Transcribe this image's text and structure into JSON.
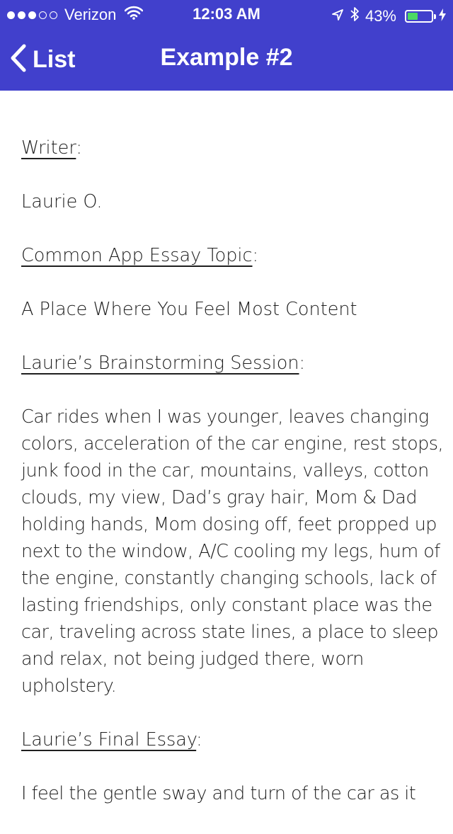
{
  "status_bar": {
    "carrier": "Verizon",
    "time": "12:03 AM",
    "battery_percent_text": "43%",
    "battery_level": 0.43,
    "signal_bars_filled": 3,
    "signal_bars_total": 5
  },
  "nav": {
    "back_label": "List",
    "title": "Example #2"
  },
  "article": {
    "writer_heading": "Writer",
    "writer_name": "Laurie O.",
    "topic_heading": "Common App Essay Topic",
    "topic": "A Place Where You Feel Most Content",
    "brainstorm_heading": "Laurie’s Brainstorming Session",
    "brainstorm_text": "Car rides when I was younger, leaves changing colors, acceleration of the car engine, rest stops, junk food in the car, mountains, valleys, cotton clouds, my view, Dad’s gray hair, Mom & Dad holding hands, Mom dosing off, feet propped up next to the window, A/C cooling my legs, hum of the engine, constantly changing schools, lack of lasting friendships, only constant place was the car, traveling across state lines, a place to sleep and relax, not being judged there, worn upholstery.",
    "final_heading": "Laurie’s Final Essay",
    "final_text_start": "I feel the gentle sway and turn of the car as it"
  },
  "colors": {
    "nav_bg": "#4140cc",
    "battery_fill": "#4cd964",
    "text": "#1f1f1f"
  },
  "icons": [
    "location-arrow-icon",
    "bluetooth-icon",
    "wifi-icon",
    "battery-icon",
    "charging-bolt-icon",
    "back-chevron-icon"
  ]
}
